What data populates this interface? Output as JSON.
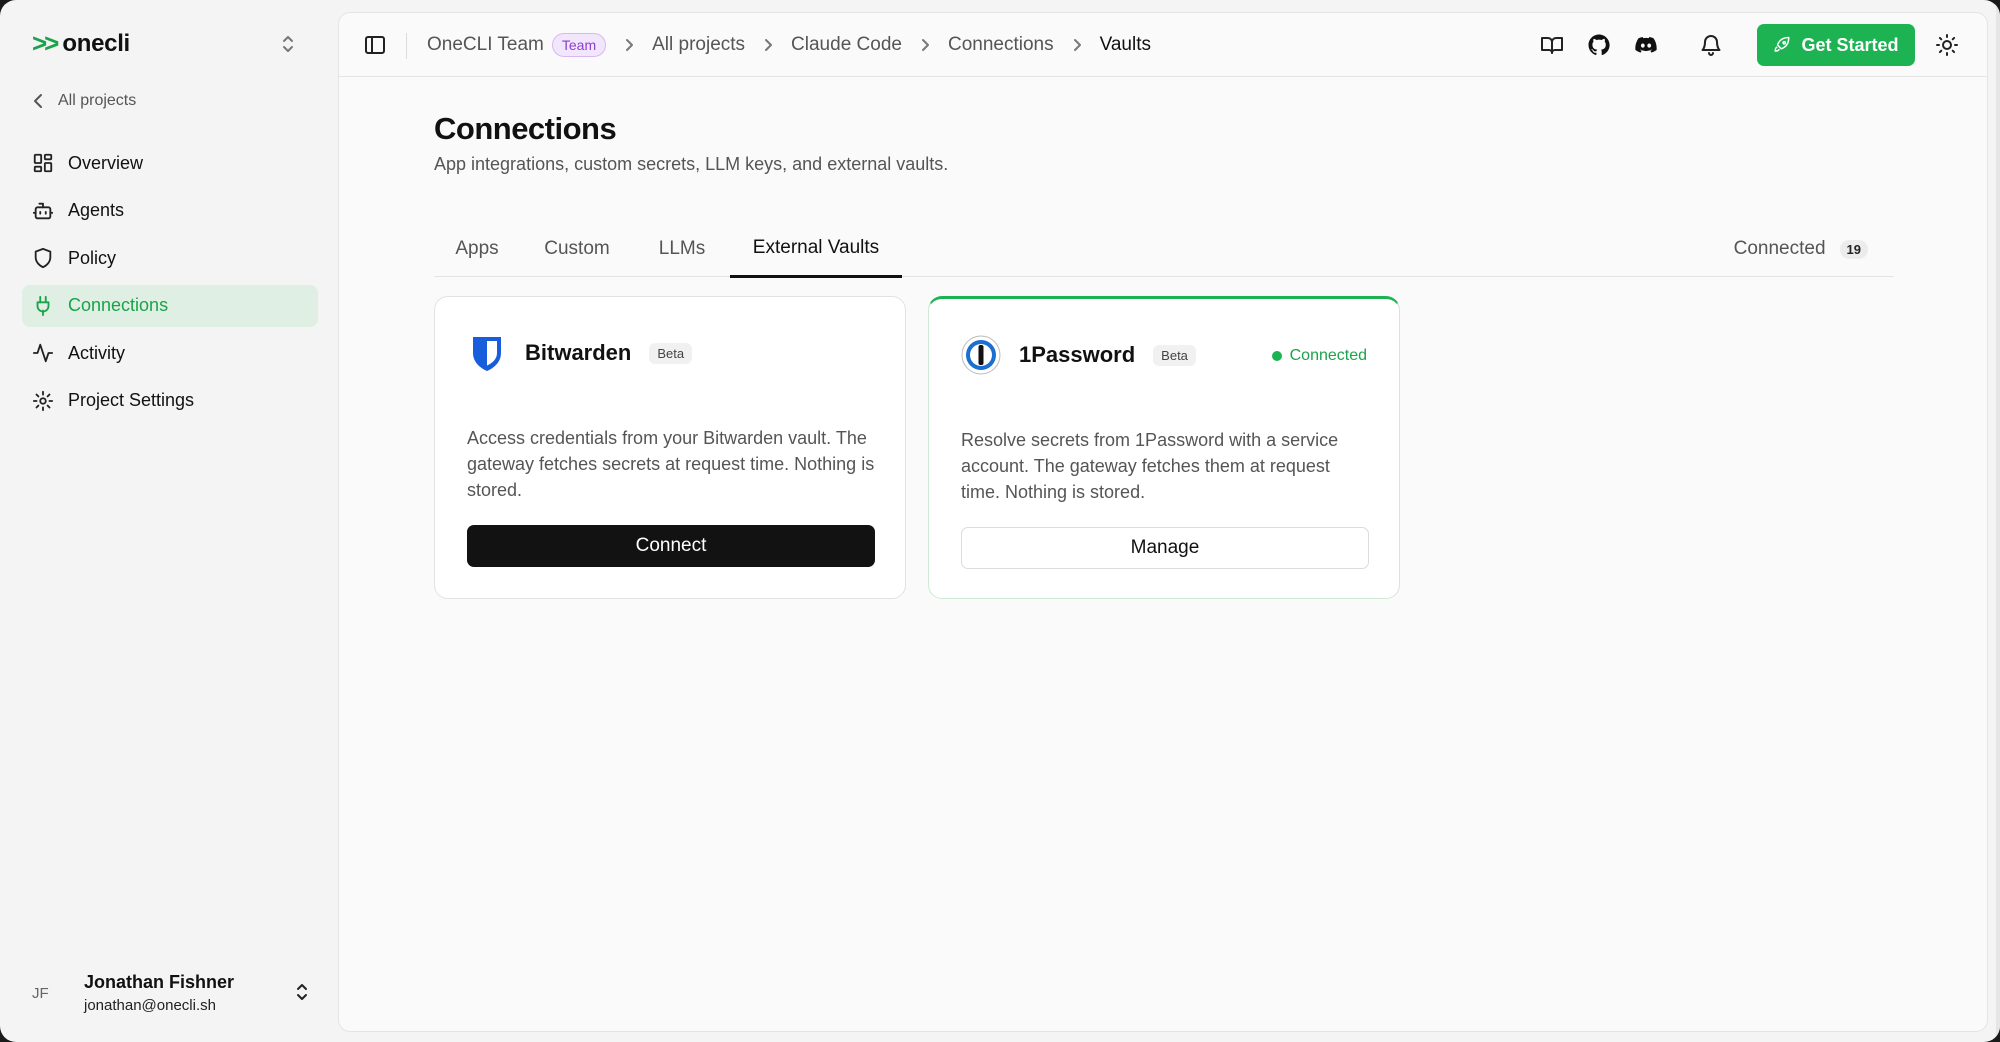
{
  "brand": {
    "logo": ">>",
    "name": "onecli"
  },
  "sidebar": {
    "back_label": "All projects",
    "items": [
      {
        "label": "Overview",
        "icon": "layout-dashboard-icon"
      },
      {
        "label": "Agents",
        "icon": "bot-icon"
      },
      {
        "label": "Policy",
        "icon": "shield-icon"
      },
      {
        "label": "Connections",
        "icon": "plug-icon",
        "active": true
      },
      {
        "label": "Activity",
        "icon": "activity-icon"
      },
      {
        "label": "Project Settings",
        "icon": "gear-icon"
      }
    ]
  },
  "user": {
    "initials": "JF",
    "name": "Jonathan Fishner",
    "email": "jonathan@onecli.sh"
  },
  "breadcrumb": {
    "team": "OneCLI Team",
    "team_badge": "Team",
    "items": [
      "All projects",
      "Claude Code",
      "Connections",
      "Vaults"
    ]
  },
  "topbar": {
    "get_started_label": "Get Started"
  },
  "page": {
    "title": "Connections",
    "subtitle": "App integrations, custom secrets, LLM keys, and external vaults."
  },
  "tabs": {
    "items": [
      "Apps",
      "Custom",
      "LLMs",
      "External Vaults"
    ],
    "active": "External Vaults",
    "connected_label": "Connected",
    "connected_count": "19"
  },
  "vaults": [
    {
      "name": "Bitwarden",
      "badge": "Beta",
      "description": "Access credentials from your Bitwarden vault. The gateway fetches secrets at request time. Nothing is stored.",
      "action": "Connect"
    },
    {
      "name": "1Password",
      "badge": "Beta",
      "status": "Connected",
      "description": "Resolve secrets from 1Password with a service account. The gateway fetches them at request time. Nothing is stored.",
      "action": "Manage"
    }
  ],
  "colors": {
    "accent": "#1db352",
    "accent_bg": "#e0efe3",
    "team_badge": "#8a3fcf",
    "bitwarden": "#175ddc"
  }
}
